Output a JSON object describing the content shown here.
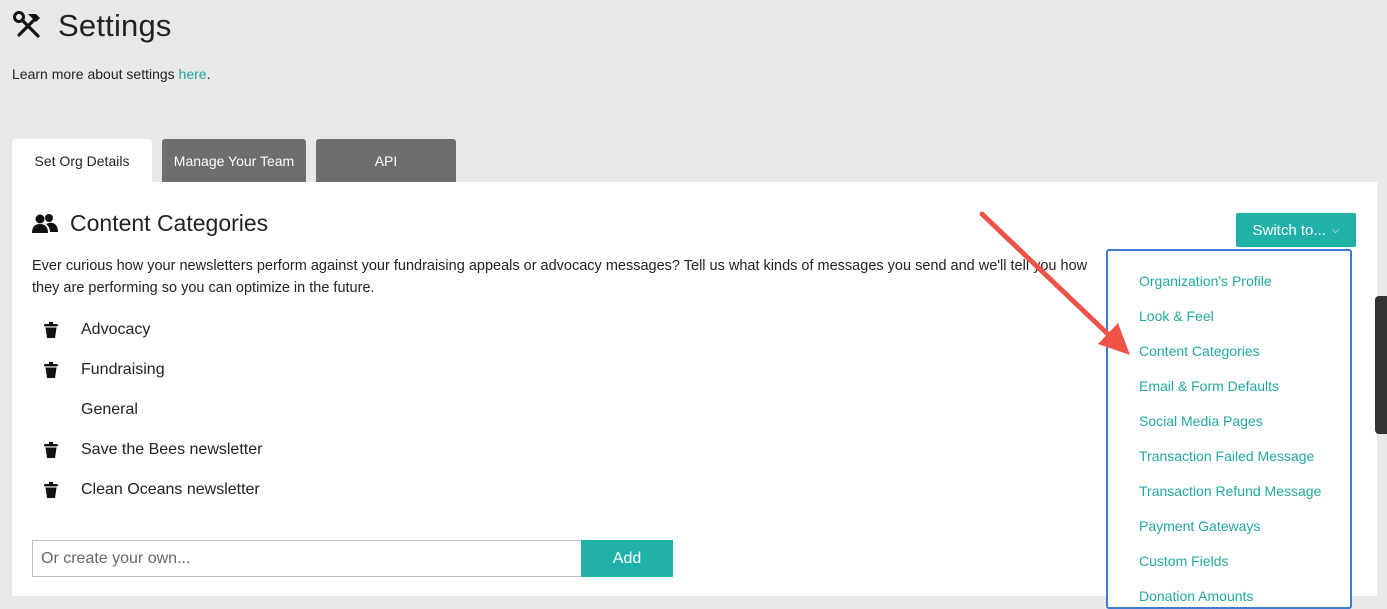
{
  "header": {
    "title": "Settings",
    "learn_more_text": "Learn more about settings ",
    "learn_more_link": "here",
    "learn_more_suffix": "."
  },
  "tabs": [
    {
      "label": "Set Org Details",
      "active": true
    },
    {
      "label": "Manage Your Team",
      "active": false
    },
    {
      "label": "API",
      "active": false
    }
  ],
  "section": {
    "title": "Content Categories",
    "description": "Ever curious how your newsletters perform against your fundraising appeals or advocacy messages? Tell us what kinds of messages you send and we'll tell you how they are performing so you can optimize in the future."
  },
  "categories": [
    {
      "label": "Advocacy",
      "deletable": true
    },
    {
      "label": "Fundraising",
      "deletable": true
    },
    {
      "label": "General",
      "deletable": false
    },
    {
      "label": "Save the Bees newsletter",
      "deletable": true
    },
    {
      "label": "Clean Oceans newsletter",
      "deletable": true
    }
  ],
  "create": {
    "placeholder": "Or create your own...",
    "add_label": "Add"
  },
  "switch_to": {
    "label": "Switch to...",
    "items": [
      "Organization's Profile",
      "Look & Feel",
      "Content Categories",
      "Email & Form Defaults",
      "Social Media Pages",
      "Transaction Failed Message",
      "Transaction Refund Message",
      "Payment Gateways",
      "Custom Fields",
      "Donation Amounts"
    ]
  },
  "colors": {
    "accent": "#20b2a8",
    "link": "#20a8a0",
    "tab_inactive": "#6e6e6e",
    "dropdown_border": "#3b7bd1",
    "annotation_arrow": "#ef5246"
  }
}
